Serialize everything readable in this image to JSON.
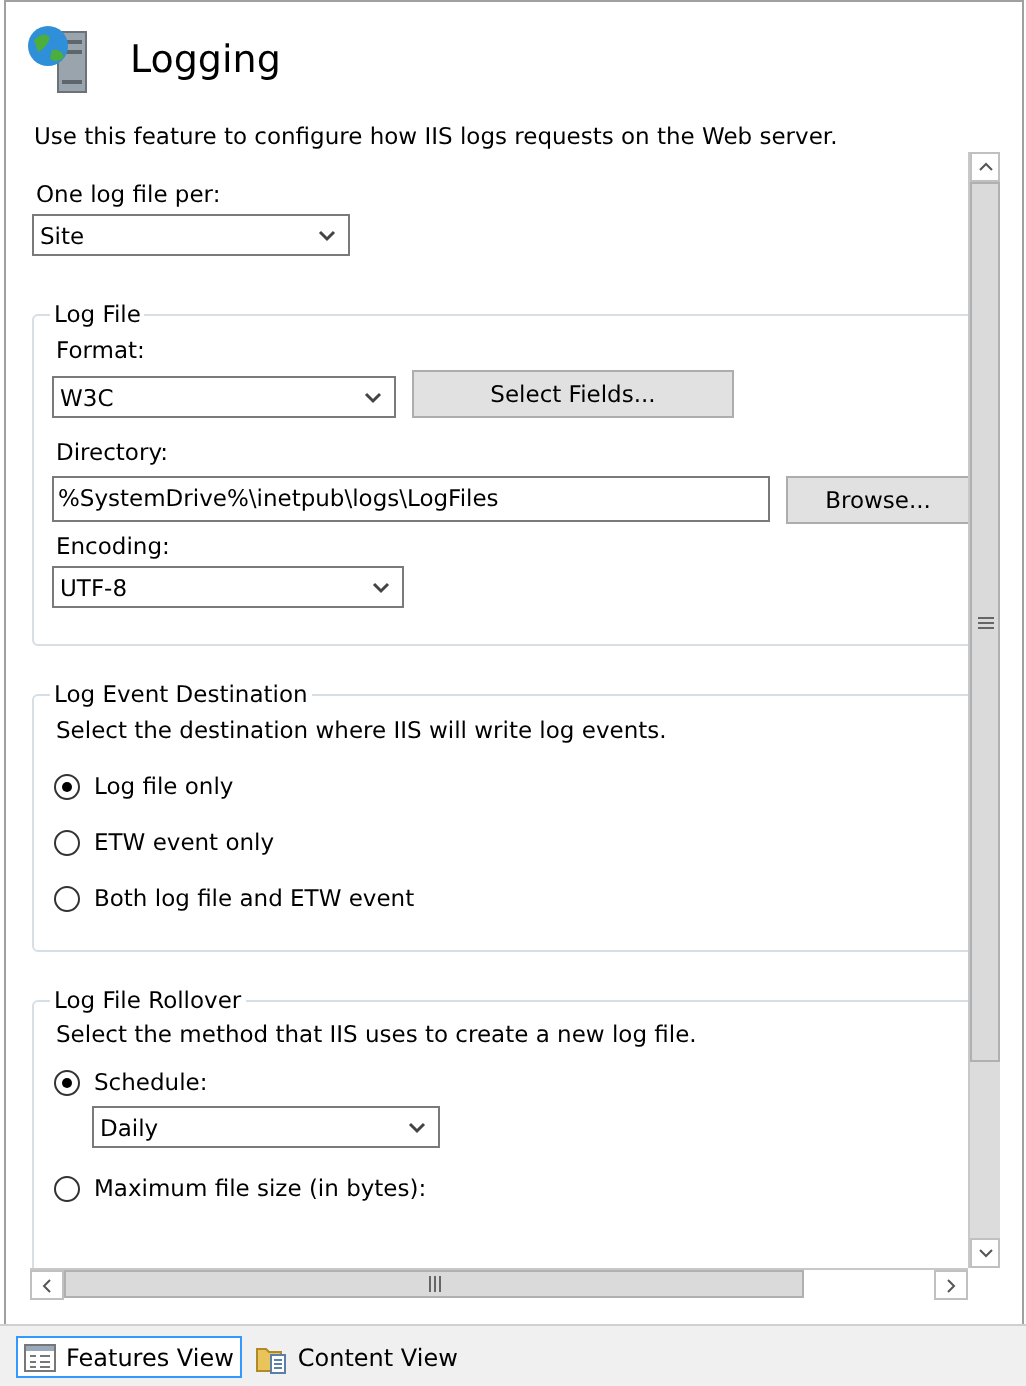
{
  "header": {
    "title": "Logging"
  },
  "description": "Use this feature to configure how IIS logs requests on the Web server.",
  "log_file_per": {
    "label": "One log file per:",
    "value": "Site"
  },
  "log_file": {
    "legend": "Log File",
    "format": {
      "label": "Format:",
      "value": "W3C"
    },
    "select_fields_button": "Select Fields...",
    "directory": {
      "label": "Directory:",
      "value": "%SystemDrive%\\inetpub\\logs\\LogFiles"
    },
    "browse_button": "Browse...",
    "encoding": {
      "label": "Encoding:",
      "value": "UTF-8"
    }
  },
  "log_event_destination": {
    "legend": "Log Event Destination",
    "description": "Select the destination where IIS will write log events.",
    "options": [
      {
        "label": "Log file only",
        "selected": true
      },
      {
        "label": "ETW event only",
        "selected": false
      },
      {
        "label": "Both log file and ETW event",
        "selected": false
      }
    ]
  },
  "log_file_rollover": {
    "legend": "Log File Rollover",
    "description": "Select the method that IIS uses to create a new log file.",
    "options": [
      {
        "label": "Schedule:",
        "selected": true,
        "value": "Daily"
      },
      {
        "label": "Maximum file size (in bytes):",
        "selected": false
      }
    ]
  },
  "view_tabs": [
    {
      "label": "Features View",
      "selected": true
    },
    {
      "label": "Content View",
      "selected": false
    }
  ]
}
